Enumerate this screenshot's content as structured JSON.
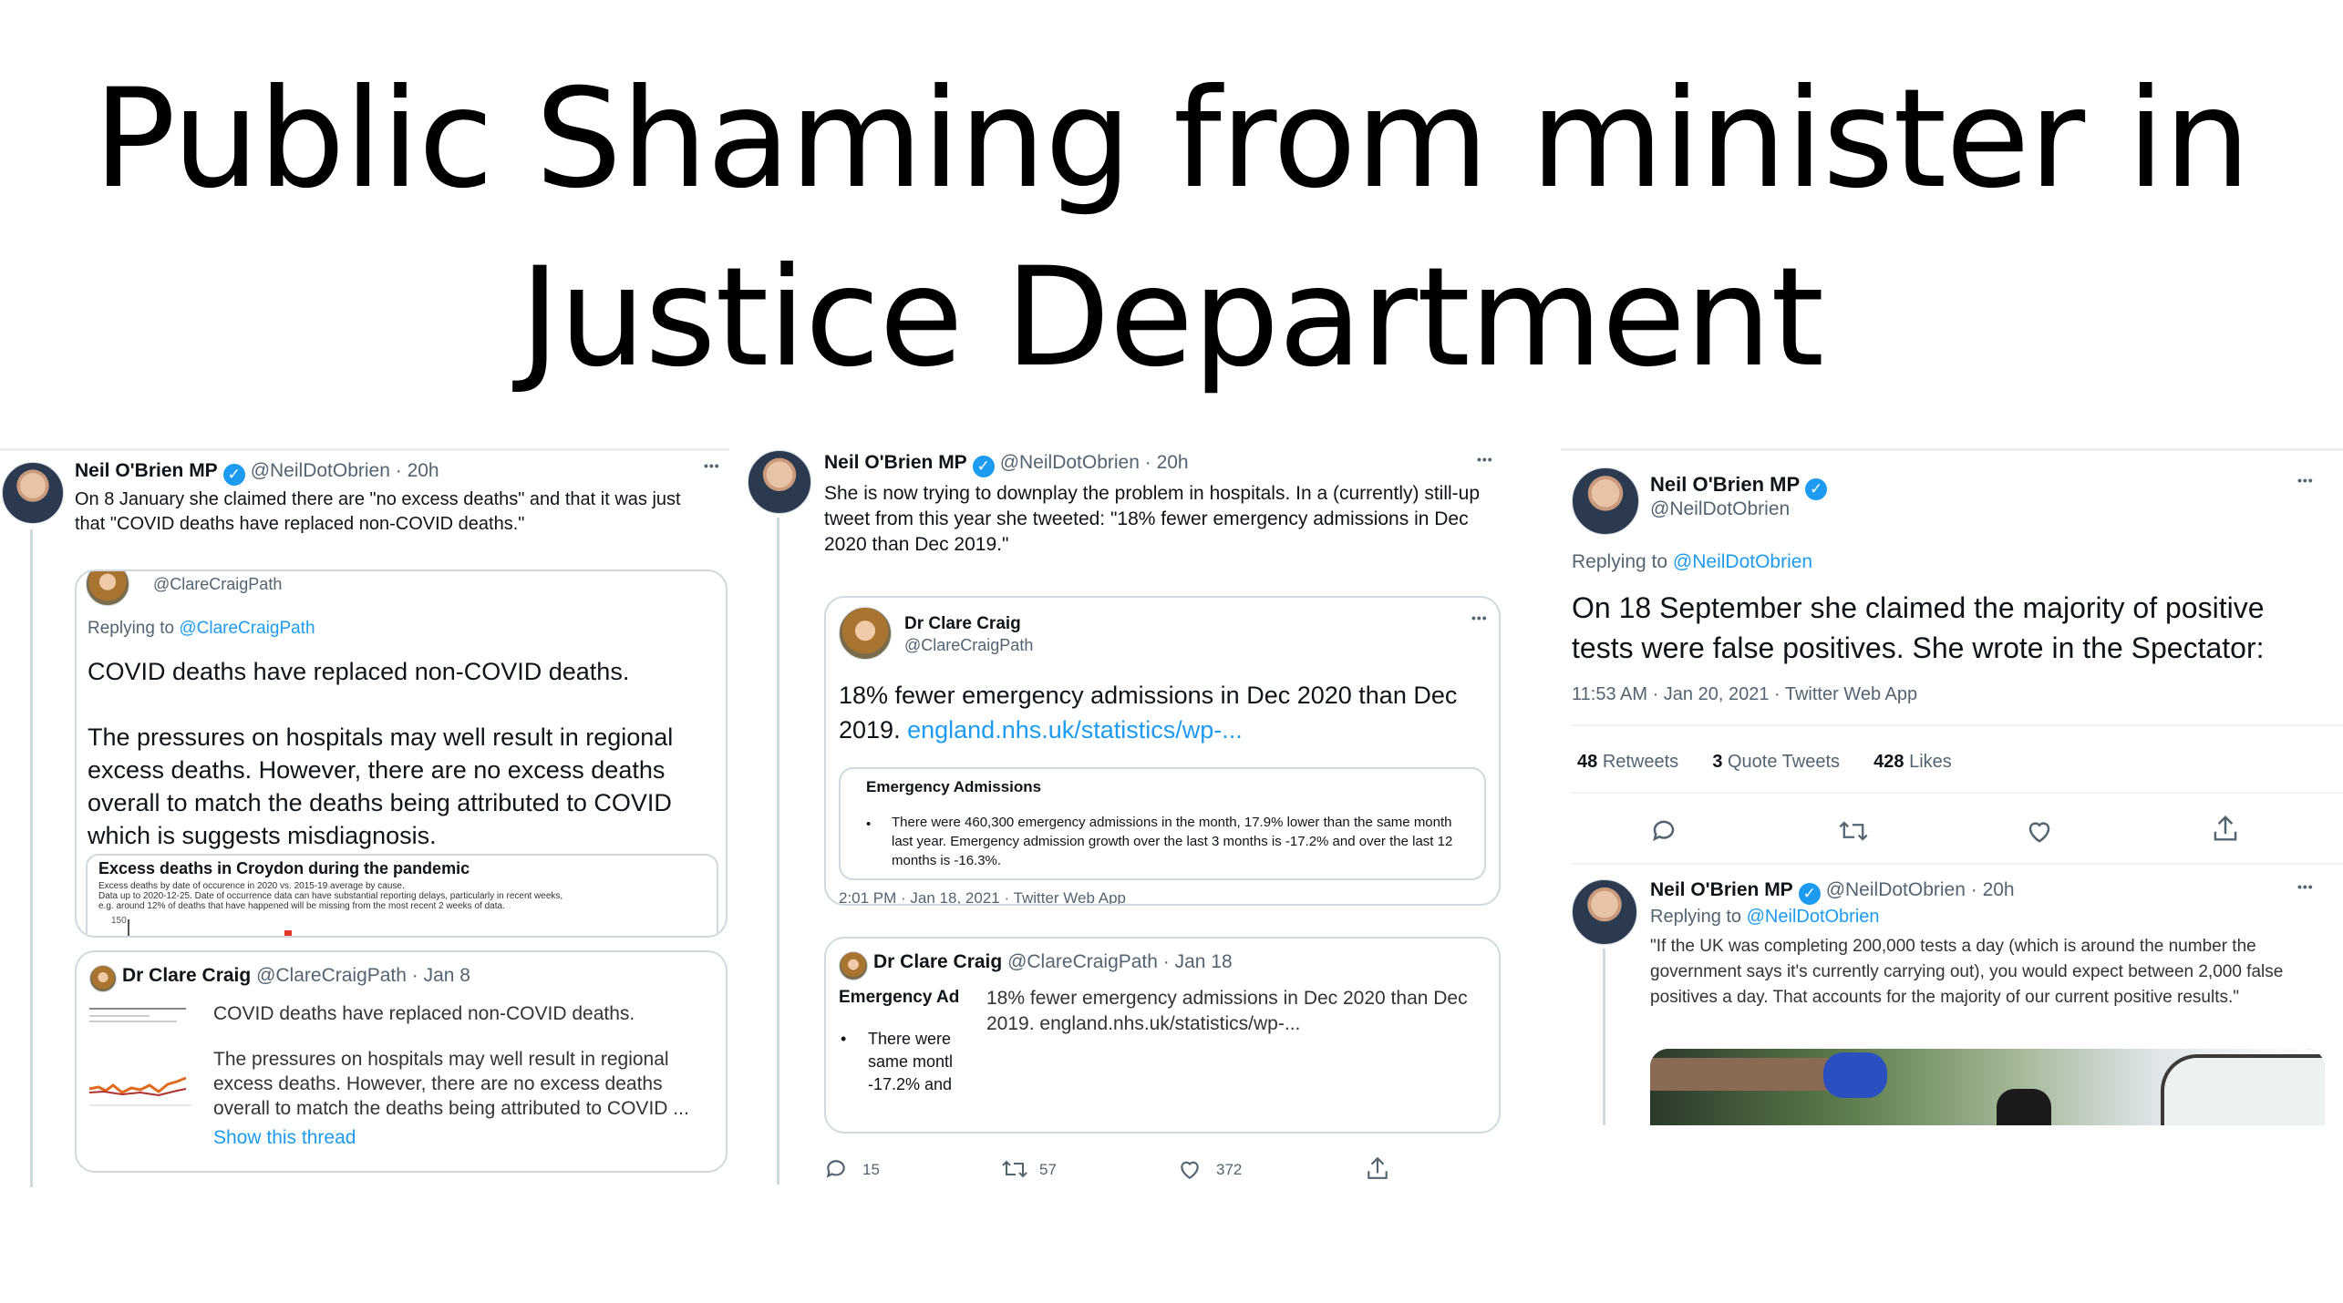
{
  "slide": {
    "title_line1": "Public Shaming from minister in",
    "title_line2": "Justice Department"
  },
  "tweet1": {
    "author": "Neil O'Brien MP",
    "handle_time": "@NeilDotObrien · 20h",
    "text": "On 8 January she claimed there are \"no excess deaths\" and that it was just that \"COVID deaths have replaced non-COVID deaths.\"",
    "quoted": {
      "handle": "@ClareCraigPath",
      "replying_prefix": "Replying to",
      "replying_handle": "@ClareCraigPath",
      "line1": "COVID deaths have replaced non-COVID deaths.",
      "para2": "The pressures on hospitals may well result in regional excess deaths. However, there are no excess deaths overall to match the deaths being attributed to COVID which is suggests misdiagnosis.",
      "chart_title": "Excess deaths in Croydon during the pandemic",
      "chart_sub1": "Excess deaths by date of occurence in 2020 vs. 2015-19 average by cause.",
      "chart_sub2": "Data up to 2020-12-25. Date of occurrence data can have substantial reporting delays, particularly in recent weeks,",
      "chart_sub3": "e.g. around 12% of deaths that have happened will be missing from the most recent 2 weeks of data.",
      "chart_tick": "150"
    },
    "second": {
      "author": "Dr Clare Craig",
      "handle_time": "@ClareCraigPath · Jan 8",
      "line1": "COVID deaths have replaced non-COVID deaths.",
      "para2": "The pressures on hospitals may well result in regional excess deaths. However, there are no excess deaths overall to match the deaths being attributed to COVID ...",
      "show_thread": "Show this thread"
    }
  },
  "tweet2": {
    "author": "Neil O'Brien MP",
    "handle_time": "@NeilDotObrien · 20h",
    "more": "•••",
    "text": "She is now trying to downplay the problem in hospitals.  In a (currently) still-up tweet from this year she tweeted: \"18% fewer emergency admissions in Dec 2020 than Dec 2019.\"",
    "quoted": {
      "author": "Dr Clare Craig",
      "handle": "@ClareCraigPath",
      "text": "18% fewer emergency admissions in Dec 2020 than Dec 2019.",
      "link": "england.nhs.uk/statistics/wp-...",
      "box_title": "Emergency Admissions",
      "box_bullet": "There were 460,300 emergency admissions in the month, 17.9% lower than the same month last year.  Emergency admission growth over the last 3 months is -17.2% and over the last 12 months is -16.3%.",
      "timestamp": "2:01 PM · Jan 18, 2021 · Twitter Web App"
    },
    "embedded": {
      "author": "Dr Clare Craig",
      "handle_time": "@ClareCraigPath · Jan 18",
      "thumb_title": "Emergency Ad",
      "thumb_bullet": "There were same montl -17.2% and",
      "text": "18% fewer emergency admissions in Dec 2020 than Dec 2019.  england.nhs.uk/statistics/wp-..."
    },
    "actions": {
      "replies": "15",
      "retweets": "57",
      "likes": "372"
    }
  },
  "tweet3": {
    "author": "Neil O'Brien MP",
    "handle": "@NeilDotObrien",
    "replying_prefix": "Replying to",
    "replying_handle": "@NeilDotObrien",
    "text": "On 18 September she claimed the majority of positive tests were false positives. She wrote in the Spectator:",
    "meta": "11:53 AM · Jan 20, 2021 · Twitter Web App",
    "stats": {
      "retweets": "48",
      "retweets_label": "Retweets",
      "quotes": "3",
      "quotes_label": "Quote Tweets",
      "likes": "428",
      "likes_label": "Likes"
    },
    "reply": {
      "author": "Neil O'Brien MP",
      "handle_time": "@NeilDotObrien · 20h",
      "replying_prefix": "Replying to",
      "replying_handle": "@NeilDotObrien",
      "text": "\"If the UK was completing 200,000 tests a day (which is around the number the government says it's currently carrying out), you would expect between 2,000 false positives a day. That accounts for the majority of our current positive results.\""
    }
  },
  "icons": {
    "verified": "checkmark-badge-icon",
    "more": "more-dots-icon",
    "reply": "comment-icon",
    "retweet": "retweet-icon",
    "like": "heart-icon",
    "share": "share-icon"
  },
  "colors": {
    "link": "#1d9bf0",
    "muted": "#536471",
    "border": "#cfd9de",
    "text": "#0f1419"
  }
}
